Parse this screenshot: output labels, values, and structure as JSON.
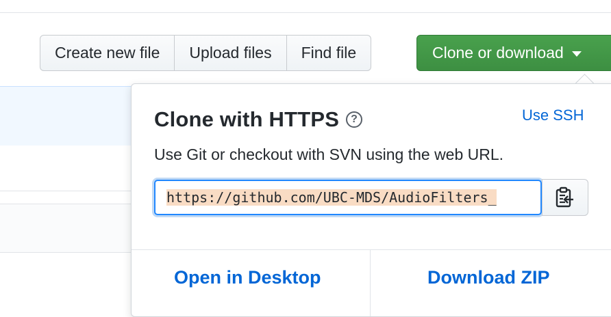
{
  "toolbar": {
    "create_new_file": "Create new file",
    "upload_files": "Upload files",
    "find_file": "Find file",
    "clone_or_download": "Clone or download"
  },
  "clone_panel": {
    "title": "Clone with HTTPS",
    "help_icon": "question-circle-icon",
    "help_glyph": "?",
    "use_ssh": "Use SSH",
    "description": "Use Git or checkout with SVN using the web URL.",
    "url": "https://github.com/UBC-MDS/AudioFilters_",
    "copy_icon": "clipboard-icon",
    "open_in_desktop": "Open in Desktop",
    "download_zip": "Download ZIP"
  },
  "colors": {
    "accent_green": "#3d8f42",
    "link_blue": "#0366d6",
    "url_highlight": "#f9dcc4"
  }
}
